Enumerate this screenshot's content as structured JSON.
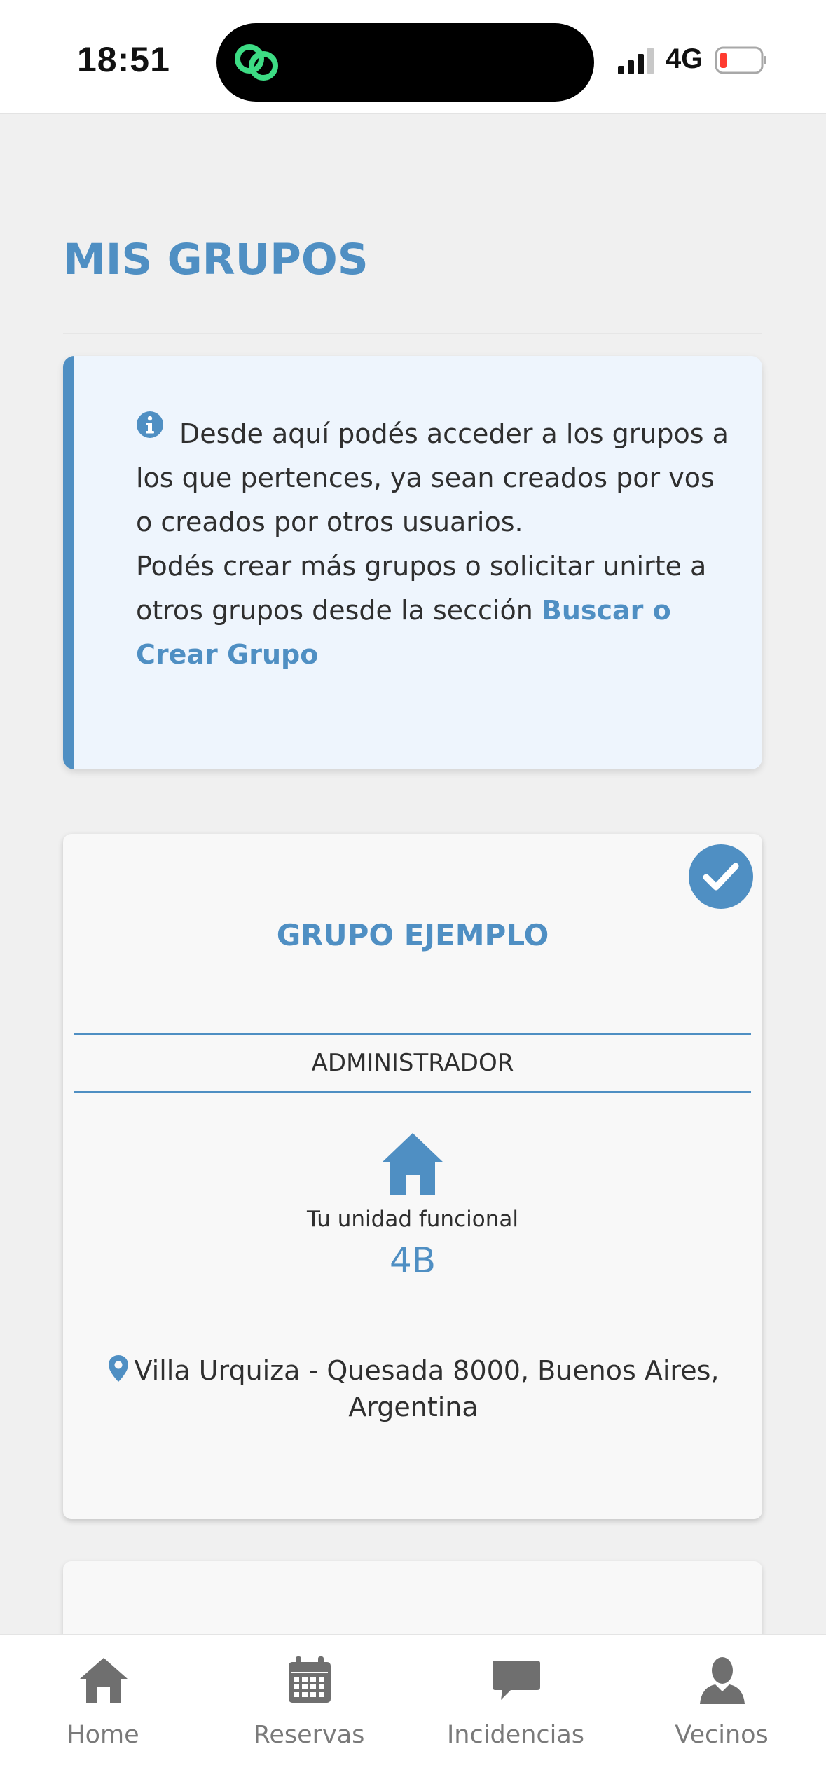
{
  "status_bar": {
    "time": "18:51",
    "network": "4G",
    "battery_color": "#ff3b30"
  },
  "page": {
    "title": "MIS GRUPOS"
  },
  "info_box": {
    "paragraph_1": "Desde aquí podés acceder a los grupos a los que pertences, ya sean creados por vos o creados por otros usuarios.",
    "paragraph_2_prefix": "Podés crear más grupos o solicitar unirte a otros grupos desde la sección ",
    "link_text": "Buscar o Crear Grupo",
    "icon": "info-icon"
  },
  "group_card": {
    "name": "GRUPO EJEMPLO",
    "role": "ADMINISTRADOR",
    "unit_label": "Tu unidad funcional",
    "unit_value": "4B",
    "location": "Villa Urquiza - Quesada 8000, Buenos Aires, Argentina",
    "selected": true
  },
  "tab_bar": {
    "items": [
      {
        "label": "Home",
        "icon": "home-icon"
      },
      {
        "label": "Reservas",
        "icon": "calendar-icon"
      },
      {
        "label": "Incidencias",
        "icon": "chat-icon"
      },
      {
        "label": "Vecinos",
        "icon": "user-icon"
      }
    ]
  },
  "colors": {
    "accent": "#4f8fc3",
    "info_bg": "#eef5fd",
    "tab_icon": "#6f6f6f"
  }
}
